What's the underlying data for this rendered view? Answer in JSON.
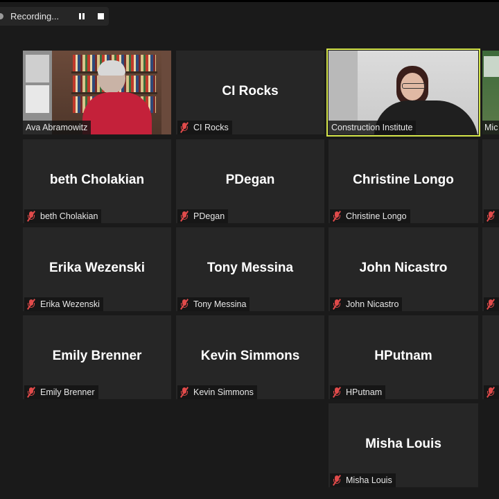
{
  "recording": {
    "status_label": "Recording...",
    "pause_icon": "pause-icon",
    "stop_icon": "stop-icon"
  },
  "participants": [
    {
      "name": "Ava Abramowitz",
      "video": true
    },
    {
      "name": "CI Rocks",
      "video": false,
      "muted": true
    },
    {
      "name": "Construction Institute",
      "video": true,
      "active_speaker": true
    },
    {
      "name": "Mic",
      "video": true,
      "partial": true
    },
    {
      "name": "beth Cholakian",
      "video": false,
      "muted": true
    },
    {
      "name": "PDegan",
      "video": false,
      "muted": true
    },
    {
      "name": "Christine Longo",
      "video": false,
      "muted": true
    },
    {
      "name": "Erika Wezenski",
      "video": false,
      "muted": true
    },
    {
      "name": "Tony Messina",
      "video": false,
      "muted": true
    },
    {
      "name": "John Nicastro",
      "video": false,
      "muted": true
    },
    {
      "name": "Emily Brenner",
      "video": false,
      "muted": true
    },
    {
      "name": "Kevin Simmons",
      "video": false,
      "muted": true
    },
    {
      "name": "HPutnam",
      "video": false,
      "muted": true
    },
    {
      "name": "Misha Louis",
      "video": false,
      "muted": true
    }
  ],
  "colors": {
    "background": "#1a1a1a",
    "tile": "#262626",
    "active_border": "#d6e64a",
    "muted_mic": "#e04a4a"
  }
}
